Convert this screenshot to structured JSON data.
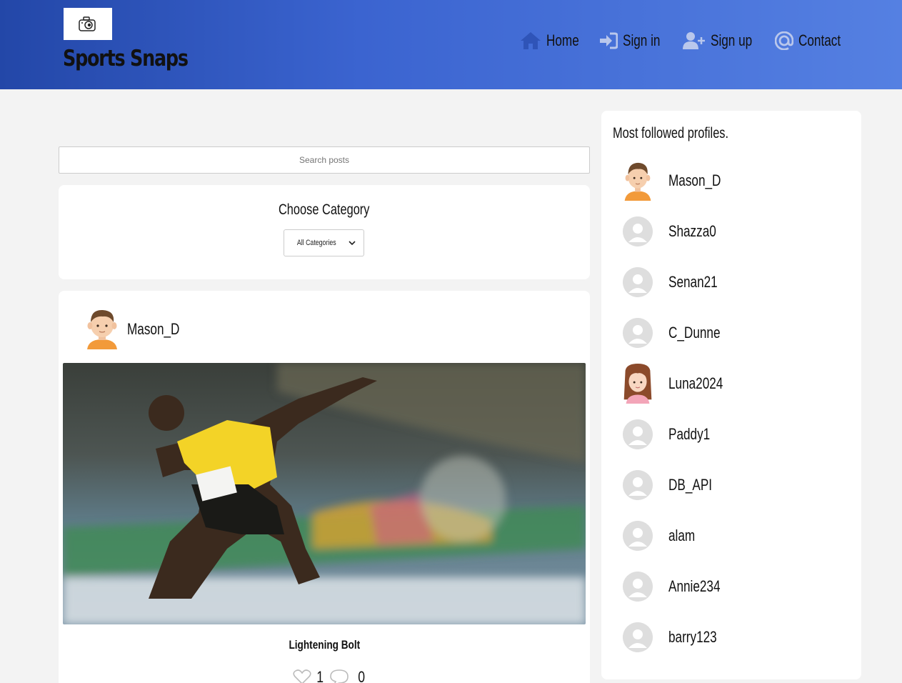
{
  "header": {
    "brand": "Sports Snaps",
    "logo_icon": "camera-icon",
    "nav": [
      {
        "label": "Home",
        "icon": "home-icon"
      },
      {
        "label": "Sign in",
        "icon": "sign-in-icon"
      },
      {
        "label": "Sign up",
        "icon": "user-plus-icon"
      },
      {
        "label": "Contact",
        "icon": "at-icon"
      }
    ]
  },
  "search": {
    "placeholder": "Search posts"
  },
  "category": {
    "title": "Choose Category",
    "selected": "All Categories"
  },
  "post": {
    "username": "Mason_D",
    "title": "Lightening Bolt",
    "likes": "1",
    "comments": "0"
  },
  "sidebar": {
    "title": "Most followed profiles.",
    "profiles": [
      {
        "name": "Mason_D",
        "avatar": "boy-avatar"
      },
      {
        "name": "Shazza0",
        "avatar": "default-avatar"
      },
      {
        "name": "Senan21",
        "avatar": "default-avatar"
      },
      {
        "name": "C_Dunne",
        "avatar": "default-avatar"
      },
      {
        "name": "Luna2024",
        "avatar": "girl-avatar"
      },
      {
        "name": "Paddy1",
        "avatar": "default-avatar"
      },
      {
        "name": "DB_API",
        "avatar": "default-avatar"
      },
      {
        "name": "alam",
        "avatar": "default-avatar"
      },
      {
        "name": "Annie234",
        "avatar": "default-avatar"
      },
      {
        "name": "barry123",
        "avatar": "default-avatar"
      }
    ]
  },
  "colors": {
    "header_start": "#2347a8",
    "header_end": "#5580e2",
    "icon": "#2f54b8"
  }
}
